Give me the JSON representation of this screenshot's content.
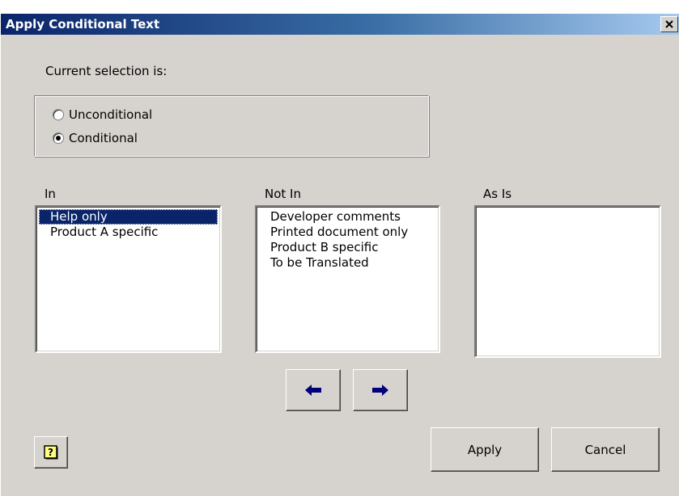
{
  "window": {
    "title": "Apply Conditional Text",
    "close_symbol": "✕"
  },
  "selection": {
    "label": "Current selection is:",
    "options": [
      {
        "label": "Unconditional",
        "checked": false
      },
      {
        "label": "Conditional",
        "checked": true
      }
    ]
  },
  "lists": {
    "in": {
      "label": "In",
      "items": [
        "Help only",
        "Product A specific"
      ],
      "selected_index": 0
    },
    "not_in": {
      "label": "Not In",
      "items": [
        "Developer comments",
        "Printed document only",
        "Product B specific",
        "To be Translated"
      ]
    },
    "as_is": {
      "label": "As Is",
      "items": []
    }
  },
  "buttons": {
    "move_left_icon": "arrow-left-icon",
    "move_right_icon": "arrow-right-icon",
    "help_icon": "help-question-icon",
    "apply_label": "Apply",
    "cancel_label": "Cancel"
  },
  "colors": {
    "title_bar_start": "#0a246a",
    "title_bar_end": "#a6caf0",
    "dialog_face": "#d6d3ce",
    "selection_highlight": "#0a246a",
    "arrow_color": "#00007b",
    "help_icon_fill": "#ffff80"
  }
}
